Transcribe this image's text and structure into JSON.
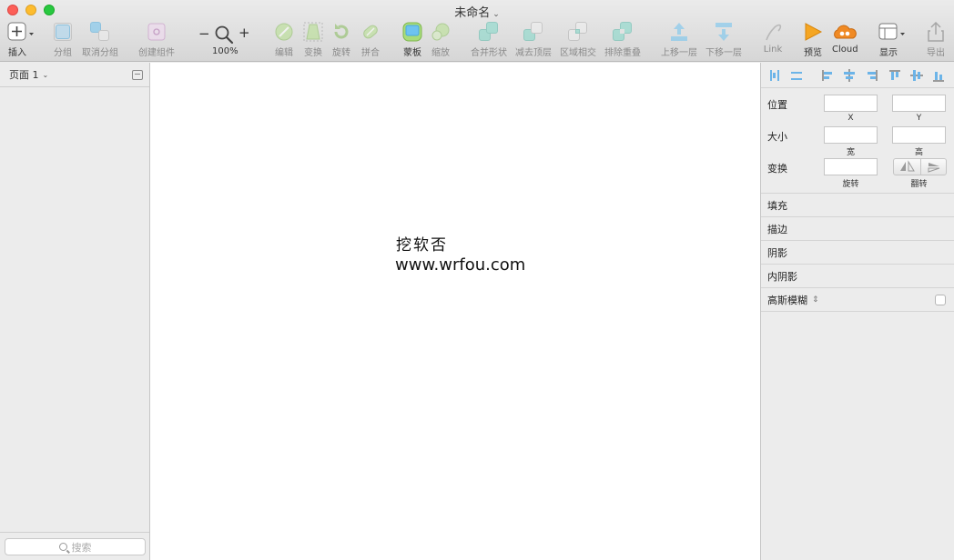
{
  "window": {
    "title": "未命名"
  },
  "toolbar": {
    "insert": "插入",
    "group": "分组",
    "ungroup": "取消分组",
    "create_symbol": "创建组件",
    "zoom_minus": "−",
    "zoom_plus": "+",
    "zoom_value": "100%",
    "edit": "编辑",
    "transform": "变换",
    "rotate": "旋转",
    "flatten": "拼合",
    "mask": "蒙板",
    "scale": "缩放",
    "union": "合并形状",
    "subtract": "减去顶层",
    "intersect": "区域相交",
    "difference": "排除重叠",
    "forward": "上移一层",
    "backward": "下移一层",
    "link": "Link",
    "preview": "预览",
    "cloud": "Cloud",
    "view": "显示",
    "export": "导出"
  },
  "sidebar": {
    "page_selector": "页面 1",
    "search_placeholder": "搜索"
  },
  "canvas": {
    "watermark_cn": "挖软否",
    "watermark_url": "www.wrfou.com"
  },
  "inspector": {
    "position_label": "位置",
    "x_label": "X",
    "y_label": "Y",
    "size_label": "大小",
    "width_label": "宽",
    "height_label": "高",
    "transform_label": "变换",
    "rotate_label": "旋转",
    "flip_label": "翻转",
    "sections": {
      "fill": "填充",
      "border": "描边",
      "shadow": "阴影",
      "inner_shadow": "内阴影",
      "blur": "高斯模糊"
    }
  },
  "colors": {
    "close": "#fc5f57",
    "minimize": "#fdbc2e",
    "zoom": "#28c840",
    "accent_teal": "#7fd8c8",
    "accent_blue": "#6ec3f0",
    "preview_orange": "#f5a623"
  }
}
